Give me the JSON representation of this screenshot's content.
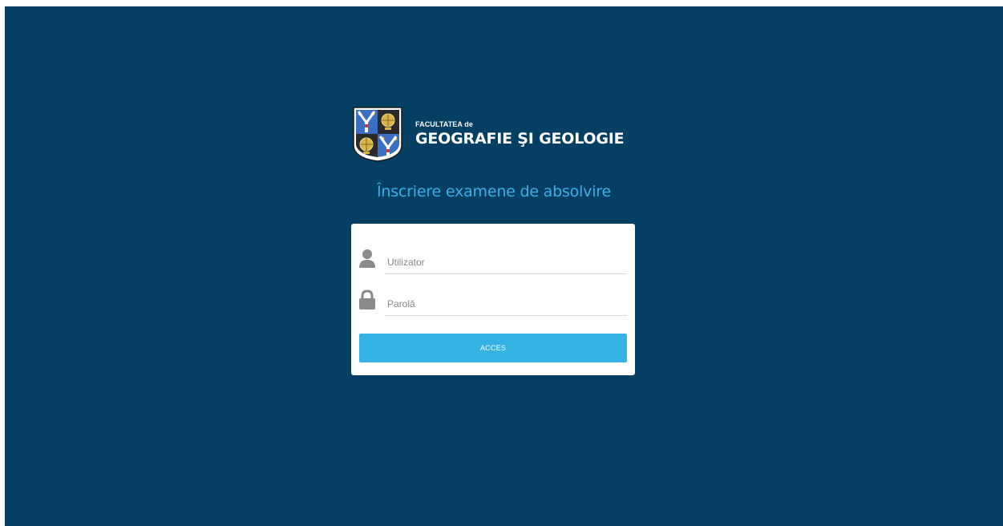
{
  "app": {
    "background_color": "#053f63",
    "accent_color": "#34b2e4"
  },
  "logo": {
    "line1": "FACULTATEA de",
    "line2": "GEOGRAFIE ŞI GEOLOGIE",
    "crest_icon": "faculty-crest-icon"
  },
  "page": {
    "title": "Înscriere examene de absolvire"
  },
  "login": {
    "username": {
      "icon": "user-icon",
      "placeholder": "Utilizator",
      "value": ""
    },
    "password": {
      "icon": "lock-icon",
      "placeholder": "Parolă",
      "value": ""
    },
    "submit_label": "ACCES"
  }
}
